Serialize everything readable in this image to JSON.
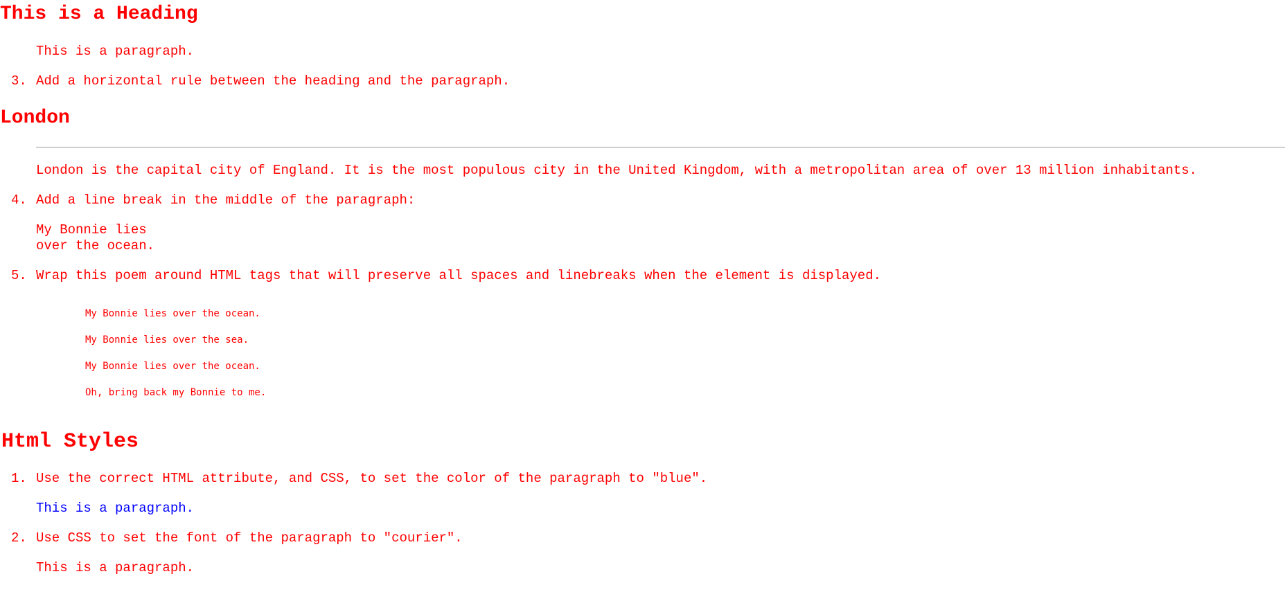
{
  "block1": {
    "heading": "This is a Heading",
    "paragraph": "This is a paragraph."
  },
  "item3": {
    "number": "3.",
    "instruction": "Add a horizontal rule between the heading and the paragraph.",
    "heading": "London",
    "paragraph": "London is the capital city of England. It is the most populous city in the United Kingdom, with a metropolitan area of over 13 million inhabitants."
  },
  "item4": {
    "number": "4.",
    "instruction": "Add a line break in the middle of the paragraph:",
    "line1": "My Bonnie lies",
    "line2": "over the ocean."
  },
  "item5": {
    "number": "5.",
    "instruction": "Wrap this poem around HTML tags that will preserve all spaces and linebreaks when the element is displayed.",
    "poem": [
      "My Bonnie lies over the ocean.",
      "My Bonnie lies over the sea.",
      "My Bonnie lies over the ocean.",
      "Oh, bring back my Bonnie to me."
    ]
  },
  "styles_section": {
    "heading": "Html Styles",
    "item1": {
      "number": "1.",
      "instruction": "Use the correct HTML attribute, and CSS, to set the color of the paragraph to \"blue\".",
      "paragraph": "This is a paragraph."
    },
    "item2": {
      "number": "2.",
      "instruction": "Use CSS to set the font of the paragraph to \"courier\".",
      "paragraph": "This is a paragraph."
    }
  },
  "colors": {
    "text": "#ff0000",
    "blue_paragraph": "#0000ff",
    "rule": "#999999"
  }
}
